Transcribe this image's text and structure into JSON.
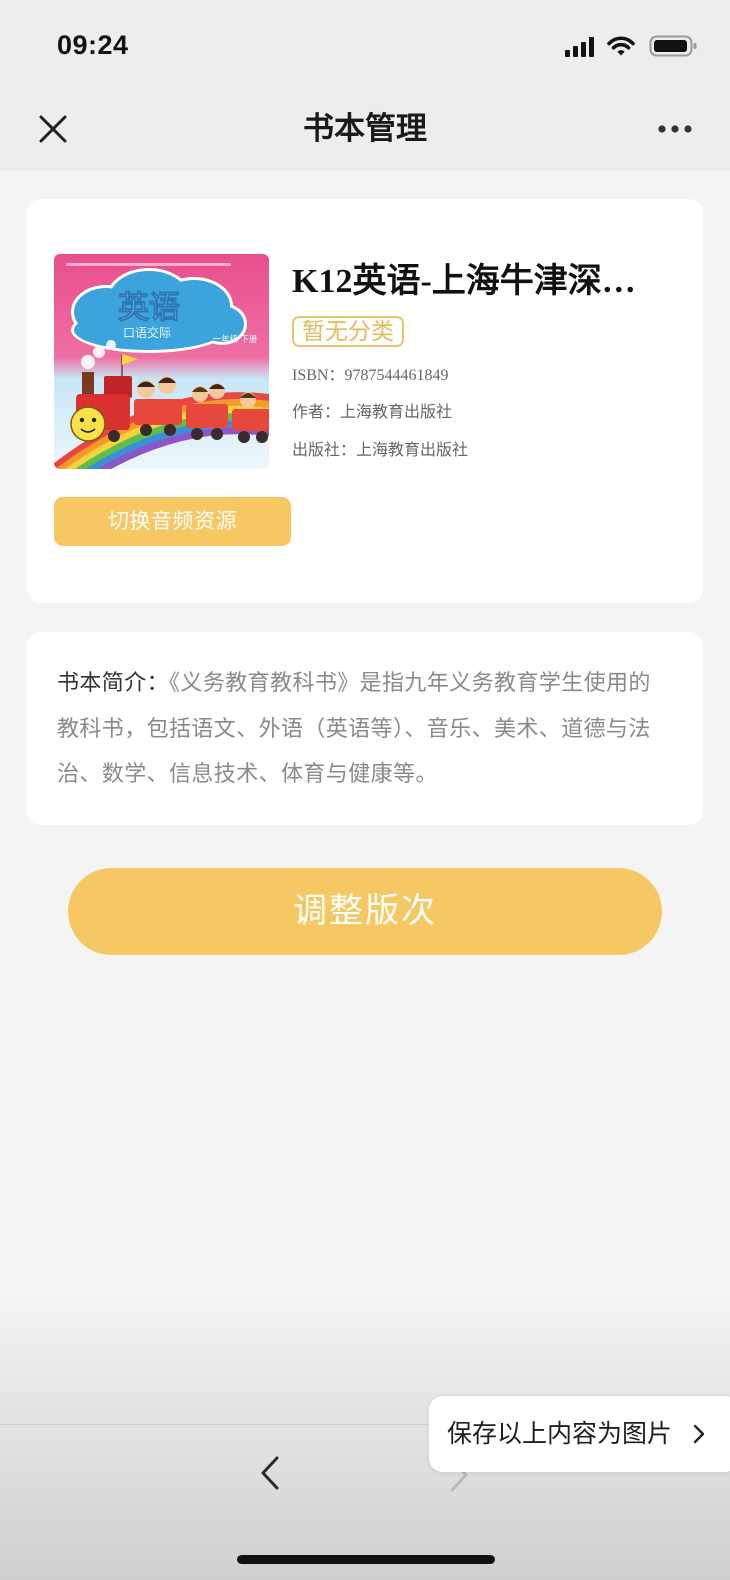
{
  "status_bar": {
    "time": "09:24",
    "icons": [
      "signal-icon",
      "wifi-icon",
      "battery-icon"
    ]
  },
  "nav": {
    "title": "书本管理",
    "close_icon": "close-icon",
    "more_icon": "more-icon"
  },
  "book": {
    "cover": {
      "title": "英语",
      "subtitle": "口语交际",
      "grade": "一年级 下册"
    },
    "title": "K12英语-上海牛津深…",
    "category_tag": "暂无分类",
    "isbn": {
      "label": "ISBN：",
      "value": "9787544461849"
    },
    "author": {
      "label": "作者：",
      "value": "上海教育出版社"
    },
    "publisher": {
      "label": "出版社：",
      "value": "上海教育出版社"
    },
    "switch_audio_button": "切换音频资源"
  },
  "intro": {
    "label": "书本简介：",
    "text": "《义务教育教科书》是指九年义务教育学生使用的教科书，包括语文、外语（英语等）、音乐、美术、道德与法治、数学、信息技术、体育与健康等。"
  },
  "adjust_edition_button": "调整版次",
  "bottom_toolbar": {
    "back_icon": "chevron-left-icon",
    "forward_icon": "chevron-right-icon",
    "forward_enabled": false
  },
  "save_popup": {
    "label": "保存以上内容为图片",
    "icon": "chevron-right-icon"
  },
  "colors": {
    "accent": "#f6c763",
    "tag": "#e8c56c",
    "page_background": "#f4f4f4",
    "header_background": "#ededed",
    "card_background": "#ffffff"
  }
}
